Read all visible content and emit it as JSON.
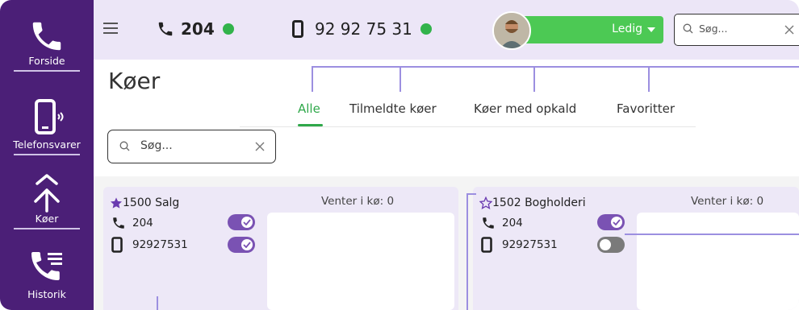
{
  "sidebar": {
    "items": [
      {
        "label": "Forside",
        "icon": "phone-icon"
      },
      {
        "label": "Telefonsvarer",
        "icon": "voicemail-phone-icon"
      },
      {
        "label": "Køer",
        "icon": "queue-split-icon"
      },
      {
        "label": "Historik",
        "icon": "call-history-icon"
      }
    ]
  },
  "topbar": {
    "extension": "204",
    "mobile": "92 92 75 31",
    "status": "Ledig",
    "search_placeholder": "Søg...",
    "presence_color": "#32b34b"
  },
  "page": {
    "title": "Køer",
    "tabs": [
      "Alle",
      "Tilmeldte køer",
      "Køer med opkald",
      "Favoritter"
    ],
    "active_tab": "Alle",
    "search_placeholder": "Søg..."
  },
  "queues": [
    {
      "name": "1500 Salg",
      "favorite": true,
      "waiting": "Venter i kø: 0",
      "extension": "204",
      "mobile": "92927531",
      "ext_enabled": true,
      "mobile_enabled": true
    },
    {
      "name": "1502 Bogholderi",
      "favorite": false,
      "waiting": "Venter i kø: 0",
      "extension": "204",
      "mobile": "92927531",
      "ext_enabled": true,
      "mobile_enabled": false
    }
  ],
  "colors": {
    "sidebar": "#4b1f77",
    "accent": "#2fa84a",
    "toggle_on": "#7a52b3",
    "status": "#4cc954"
  }
}
